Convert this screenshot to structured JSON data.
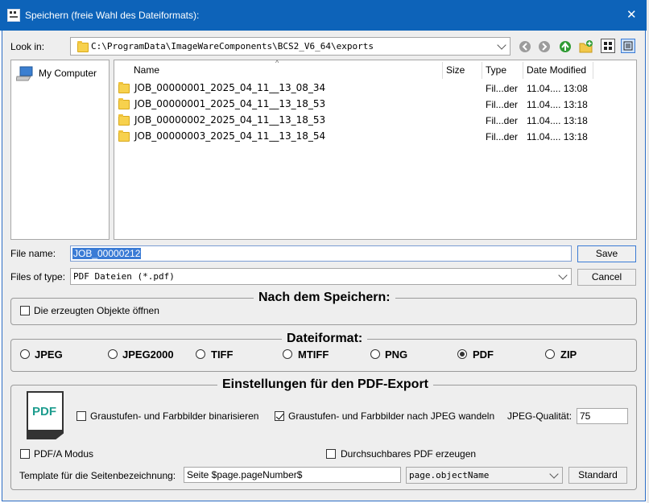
{
  "window": {
    "title": "Speichern (freie Wahl des Dateiformats):",
    "close": "✕"
  },
  "lookin": {
    "label": "Look in:",
    "path": "C:\\ProgramData\\ImageWareComponents\\BCS2_V6_64\\exports"
  },
  "sidebar": {
    "items": [
      {
        "label": "My Computer"
      }
    ]
  },
  "filelist": {
    "columns": {
      "name": "Name",
      "size": "Size",
      "type": "Type",
      "modified": "Date Modified"
    },
    "rows": [
      {
        "name": "JOB_00000001_2025_04_11__13_08_34",
        "size": "",
        "type": "Fil...der",
        "date": "11.04.... 13:08"
      },
      {
        "name": "JOB_00000001_2025_04_11__13_18_53",
        "size": "",
        "type": "Fil...der",
        "date": "11.04.... 13:18"
      },
      {
        "name": "JOB_00000002_2025_04_11__13_18_53",
        "size": "",
        "type": "Fil...der",
        "date": "11.04.... 13:18"
      },
      {
        "name": "JOB_00000003_2025_04_11__13_18_54",
        "size": "",
        "type": "Fil...der",
        "date": "11.04.... 13:18"
      }
    ]
  },
  "filename": {
    "label": "File name:",
    "value": "JOB_00000212"
  },
  "filetype": {
    "label": "Files of type:",
    "value": "PDF Dateien (*.pdf)"
  },
  "buttons": {
    "save": "Save",
    "cancel": "Cancel",
    "standard": "Standard"
  },
  "after_save": {
    "title": "Nach dem Speichern:",
    "open_label": "Die erzeugten Objekte öffnen",
    "open_checked": false
  },
  "format": {
    "title": "Dateiformat:",
    "options": [
      "JPEG",
      "JPEG2000",
      "TIFF",
      "MTIFF",
      "PNG",
      "PDF",
      "ZIP"
    ],
    "selected": "PDF"
  },
  "pdf": {
    "title": "Einstellungen für den PDF-Export",
    "icon_text": "PDF",
    "binarize_label": "Graustufen- und Farbbilder binarisieren",
    "binarize_checked": false,
    "jpeg_label": "Graustufen- und Farbbilder nach JPEG wandeln",
    "jpeg_checked": true,
    "quality_label": "JPEG-Qualität:",
    "quality_value": "75",
    "pdfa_label": "PDF/A Modus",
    "pdfa_checked": false,
    "searchable_label": "Durchsuchbares PDF erzeugen",
    "searchable_checked": false,
    "template_label": "Template für die Seitenbezeichnung:",
    "template_value": "Seite $page.pageNumber$",
    "template_var": "page.objectName"
  },
  "colors": {
    "titlebar": "#0d63b9",
    "selection": "#3a7bd5",
    "pdf_icon": "#1d9c8e"
  }
}
